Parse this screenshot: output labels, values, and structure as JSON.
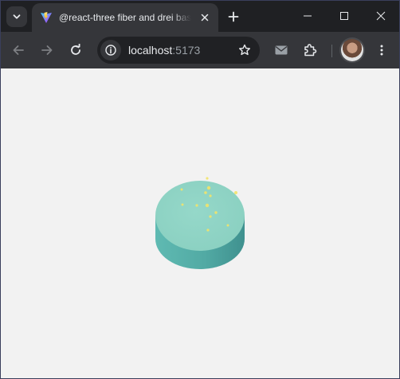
{
  "browser": {
    "tab": {
      "title": "@react-three fiber and drei basics",
      "favicon": "vite-icon"
    },
    "address_bar": {
      "host": "localhost",
      "port": ":5173"
    },
    "icons": {
      "tab_search": "chevron-down-icon",
      "close_tab": "close-icon",
      "new_tab": "plus-icon",
      "back": "arrow-left-icon",
      "forward": "arrow-right-icon",
      "reload": "reload-icon",
      "site_info": "info-icon",
      "bookmark": "star-icon",
      "mail": "mail-icon",
      "extensions": "puzzle-icon",
      "menu": "kebab-menu-icon"
    }
  },
  "scene": {
    "object": "cylinder",
    "top_color": "#8fd4c5",
    "side_color": "#5ab4ad",
    "sparkle_color": "#f3e46a",
    "background": "#f2f2f2"
  }
}
